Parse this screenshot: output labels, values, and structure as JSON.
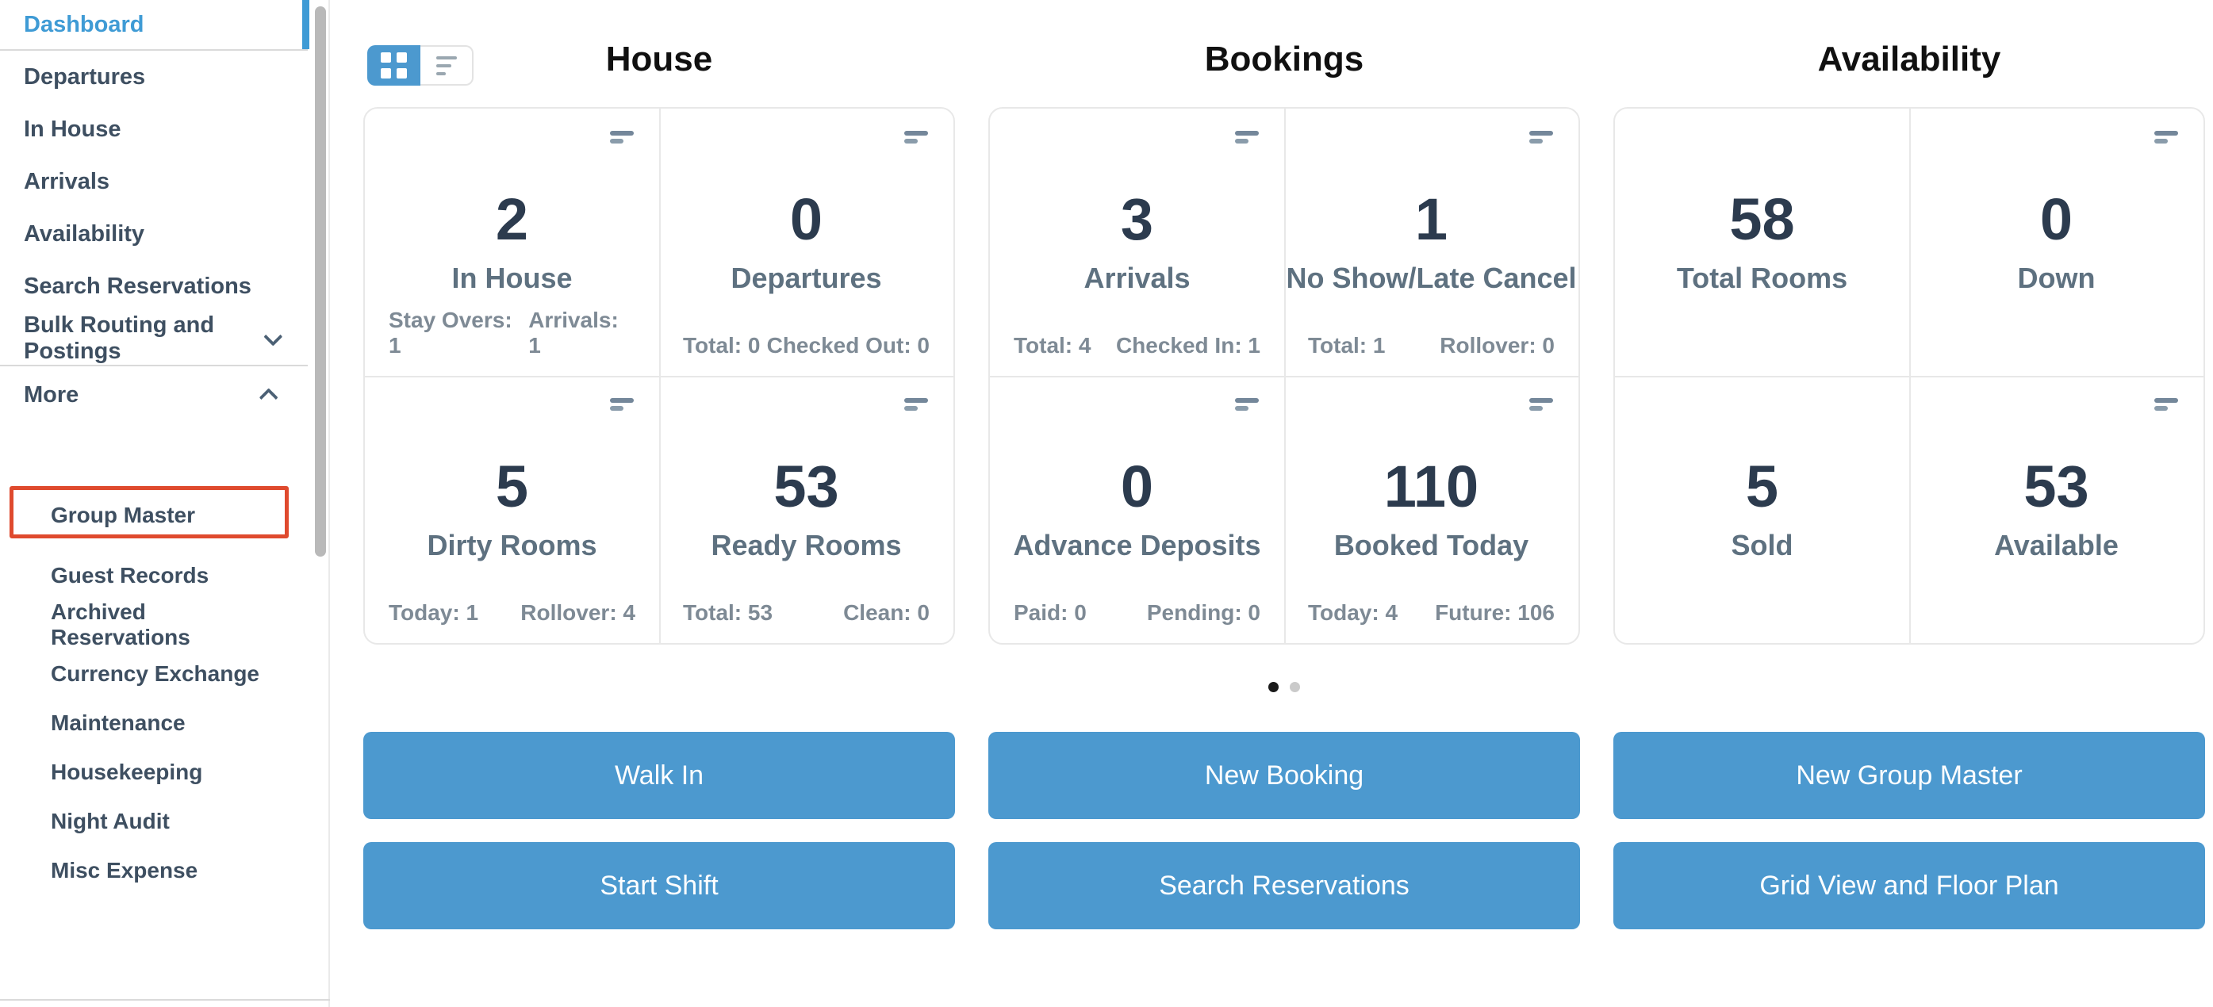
{
  "colors": {
    "accent_blue": "#4c99cf",
    "active_link_blue": "#3f9bd5",
    "highlight_red": "#df4a2e",
    "number_navy": "#2c3b4e"
  },
  "sidebar": {
    "items": [
      {
        "label": "Dashboard"
      },
      {
        "label": "Departures"
      },
      {
        "label": "In House"
      },
      {
        "label": "Arrivals"
      },
      {
        "label": "Availability"
      },
      {
        "label": "Search Reservations"
      },
      {
        "label": "Bulk Routing and Postings"
      },
      {
        "label": "More"
      }
    ],
    "subitems": [
      {
        "label": "Group Master"
      },
      {
        "label": "Guest Records"
      },
      {
        "label": "Archived Reservations"
      },
      {
        "label": "Currency Exchange"
      },
      {
        "label": "Maintenance"
      },
      {
        "label": "Housekeeping"
      },
      {
        "label": "Night Audit"
      },
      {
        "label": "Misc Expense"
      }
    ]
  },
  "view_toggle": {
    "grid_icon": "grid-view-icon",
    "list_icon": "list-view-icon"
  },
  "sections": [
    {
      "title": "House",
      "cards": [
        {
          "value": "2",
          "label": "In House",
          "stat_left": "Stay Overs: 1",
          "stat_right": "Arrivals: 1"
        },
        {
          "value": "0",
          "label": "Departures",
          "stat_left": "Total: 0",
          "stat_right": "Checked Out: 0"
        },
        {
          "value": "5",
          "label": "Dirty Rooms",
          "stat_left": "Today: 1",
          "stat_right": "Rollover: 4"
        },
        {
          "value": "53",
          "label": "Ready Rooms",
          "stat_left": "Total: 53",
          "stat_right": "Clean: 0"
        }
      ]
    },
    {
      "title": "Bookings",
      "cards": [
        {
          "value": "3",
          "label": "Arrivals",
          "stat_left": "Total: 4",
          "stat_right": "Checked In: 1"
        },
        {
          "value": "1",
          "label": "No Show/Late Cancel",
          "stat_left": "Total: 1",
          "stat_right": "Rollover: 0"
        },
        {
          "value": "0",
          "label": "Advance Deposits",
          "stat_left": "Paid: 0",
          "stat_right": "Pending: 0"
        },
        {
          "value": "110",
          "label": "Booked Today",
          "stat_left": "Today: 4",
          "stat_right": "Future: 106"
        }
      ]
    },
    {
      "title": "Availability",
      "cards": [
        {
          "value": "58",
          "label": "Total Rooms"
        },
        {
          "value": "0",
          "label": "Down"
        },
        {
          "value": "5",
          "label": "Sold"
        },
        {
          "value": "53",
          "label": "Available"
        }
      ]
    }
  ],
  "pagination": {
    "page_count": 2,
    "active_page": 1
  },
  "actions": [
    {
      "label": "Walk In"
    },
    {
      "label": "New Booking"
    },
    {
      "label": "New Group Master"
    },
    {
      "label": "Start Shift"
    },
    {
      "label": "Search Reservations"
    },
    {
      "label": "Grid View and Floor Plan"
    }
  ]
}
